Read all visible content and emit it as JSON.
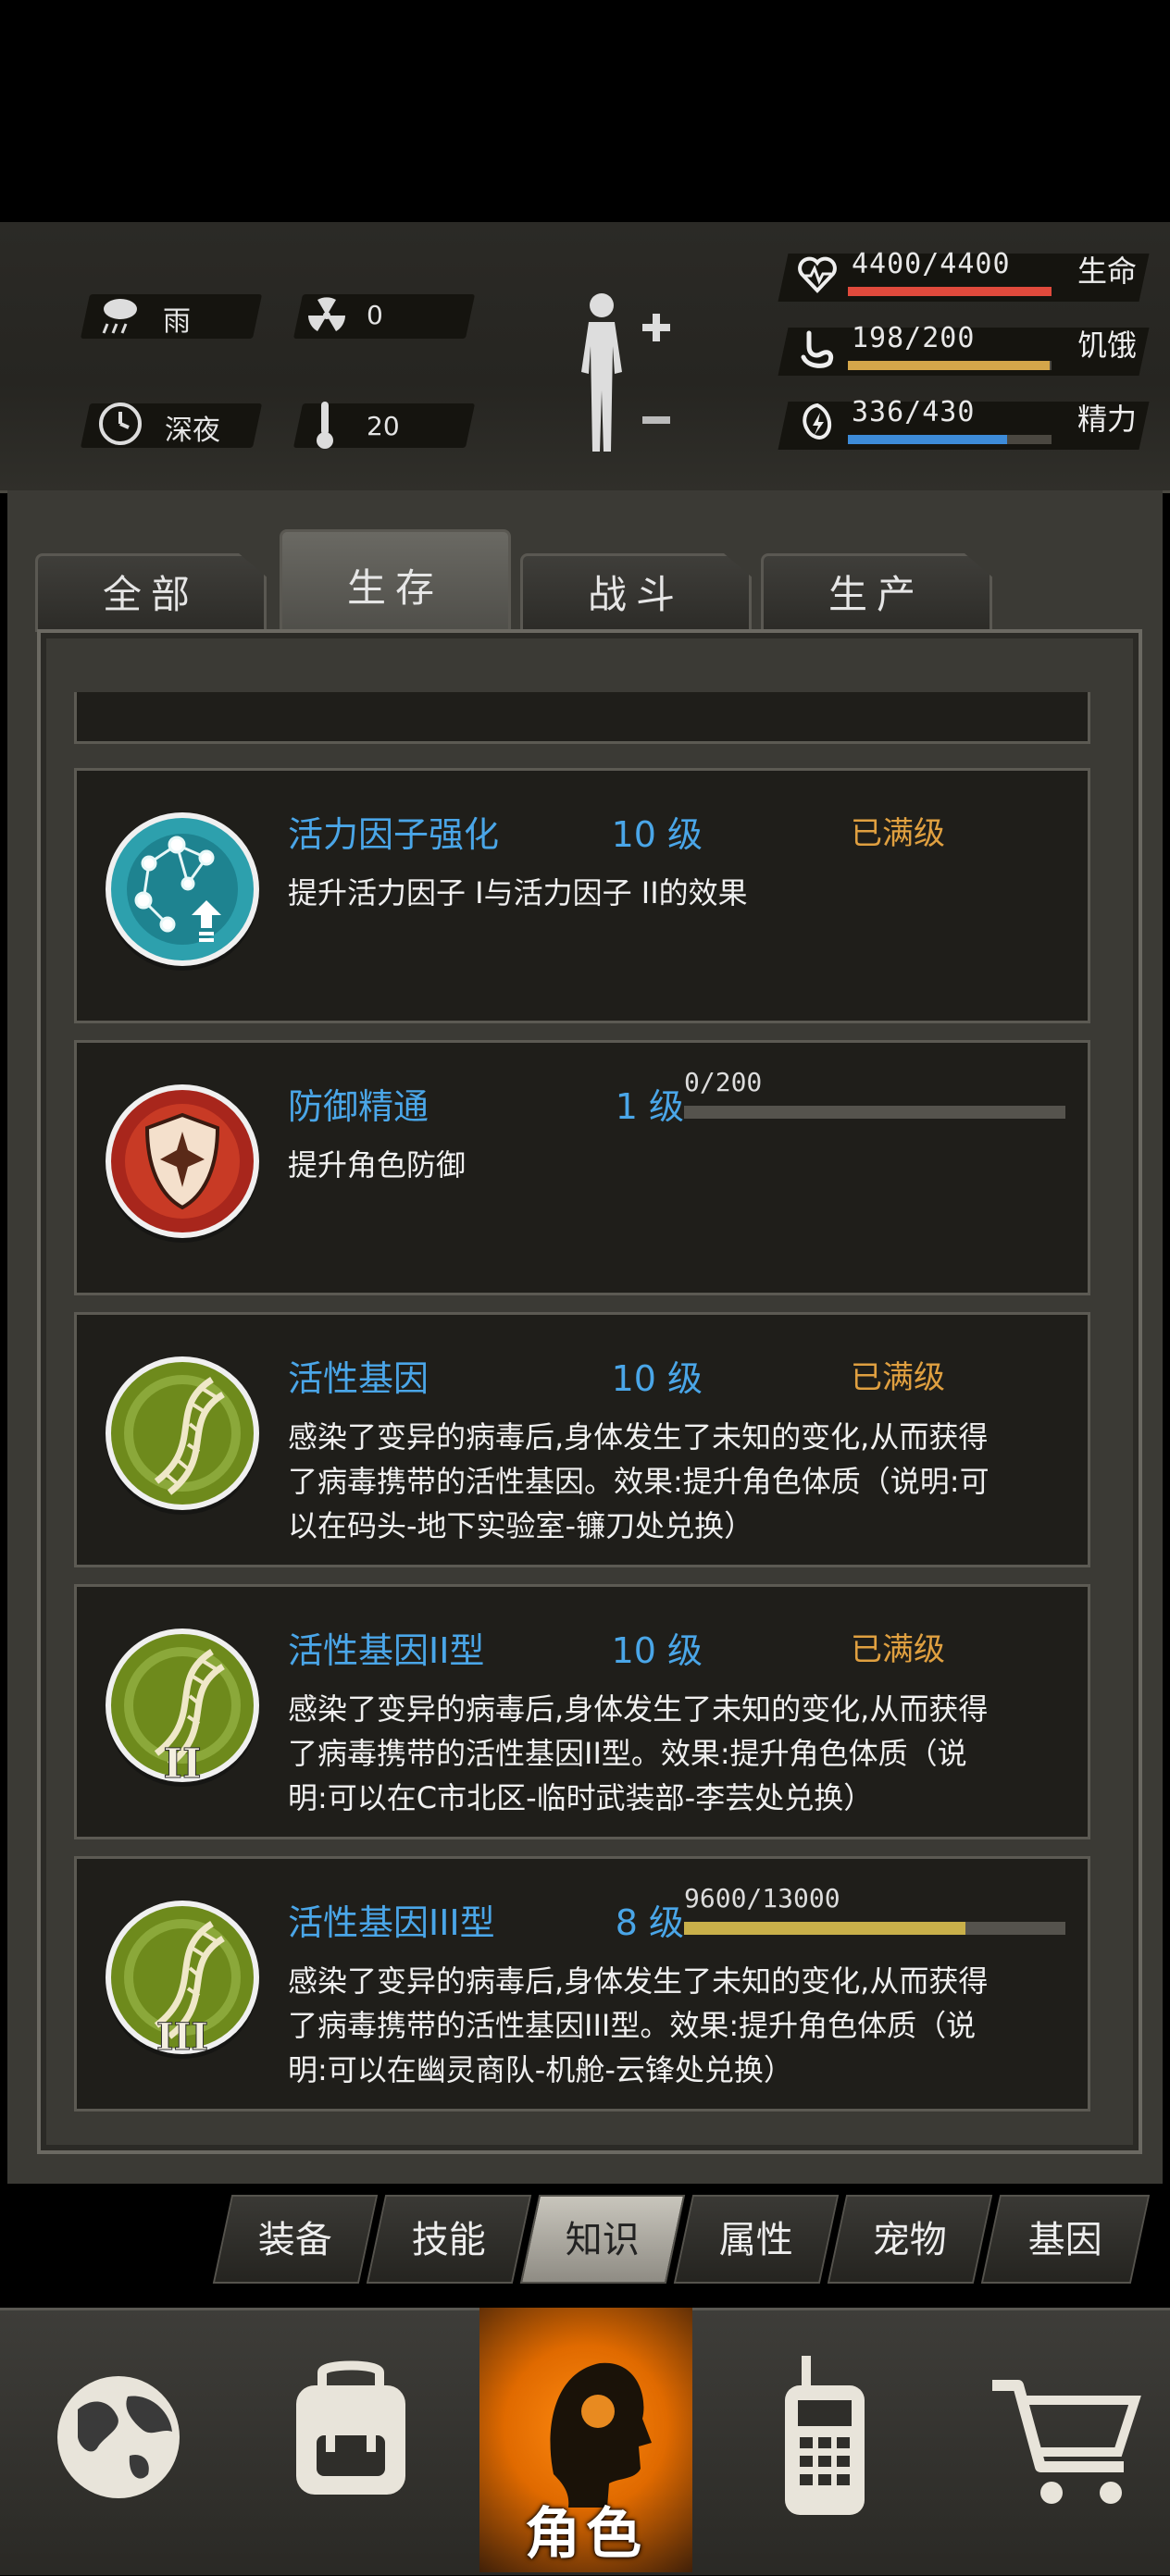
{
  "status": {
    "weather": {
      "icon": "rain-cloud-icon",
      "label": "雨"
    },
    "radiation": {
      "icon": "radiation-icon",
      "value": "0"
    },
    "time": {
      "icon": "clock-icon",
      "label": "深夜"
    },
    "temperature": {
      "icon": "thermometer-icon",
      "value": "20"
    },
    "stats": [
      {
        "name": "health",
        "value": "4400/4400",
        "label": "生命",
        "fraction": 1.0,
        "color": "#e04a3c"
      },
      {
        "name": "hunger",
        "value": "198/200",
        "label": "饥饿",
        "fraction": 0.99,
        "color": "#d4a64a"
      },
      {
        "name": "energy",
        "value": "336/430",
        "label": "精力",
        "fraction": 0.78,
        "color": "#3d8bd8"
      }
    ]
  },
  "tabs": [
    {
      "label": "全部"
    },
    {
      "label": "生存",
      "active": true
    },
    {
      "label": "战斗"
    },
    {
      "label": "生产"
    }
  ],
  "skills": [
    {
      "title": "活力因子强化",
      "level": "10 级",
      "maxed": "已满级",
      "desc": "提升活力因子 I与活力因子 II的效果",
      "emblem": "vitality-factor-icon"
    },
    {
      "title": "防御精通",
      "level": "1 级",
      "progress_text": "0/200",
      "progress": 0.0,
      "desc": "提升角色防御",
      "emblem": "defense-shield-icon"
    },
    {
      "title": "活性基因",
      "level": "10 级",
      "maxed": "已满级",
      "desc": "感染了变异的病毒后,身体发生了未知的变化,从而获得了病毒携带的活性基因。效果:提升角色体质（说明:可以在码头-地下实验室-镰刀处兑换）",
      "emblem": "dna-icon"
    },
    {
      "title": "活性基因II型",
      "level": "10 级",
      "maxed": "已满级",
      "desc": "感染了变异的病毒后,身体发生了未知的变化,从而获得了病毒携带的活性基因II型。效果:提升角色体质（说明:可以在C市北区-临时武装部-李芸处兑换）",
      "emblem": "dna-ii-icon",
      "numeral": "II"
    },
    {
      "title": "活性基因III型",
      "level": "8 级",
      "progress_text": "9600/13000",
      "progress": 0.738,
      "desc": "感染了变异的病毒后,身体发生了未知的变化,从而获得了病毒携带的活性基因III型。效果:提升角色体质（说明:可以在幽灵商队-机舱-云锋处兑换）",
      "emblem": "dna-iii-icon",
      "numeral": "III"
    }
  ],
  "subtabs": [
    {
      "label": "装备"
    },
    {
      "label": "技能"
    },
    {
      "label": "知识",
      "active": true
    },
    {
      "label": "属性"
    },
    {
      "label": "宠物"
    },
    {
      "label": "基因"
    }
  ],
  "bottom_nav": {
    "items": [
      "globe-icon",
      "backpack-icon",
      "character-head-icon",
      "radio-phone-icon",
      "shopping-cart-icon"
    ],
    "active_label": "角色"
  }
}
